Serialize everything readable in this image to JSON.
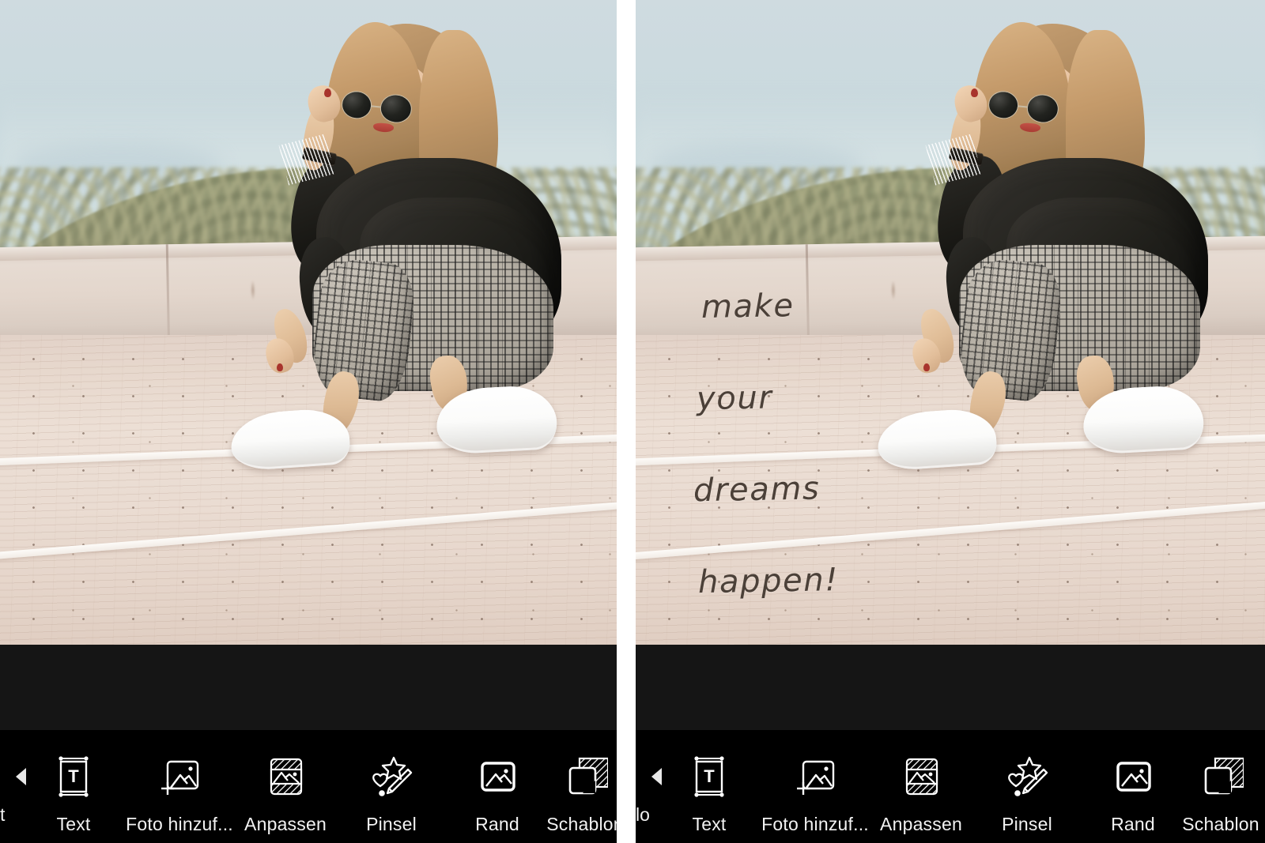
{
  "app": {
    "type": "mobile-photo-editor",
    "layout": "side-by-side-before-after",
    "accent_color": "#ffffff",
    "toolbar_bg": "#000000",
    "editor_bg": "#151515"
  },
  "panels": [
    {
      "id": "before",
      "name": "before-panel",
      "overlay_text_visible": false,
      "overlay_text": "",
      "photo": {
        "subject": "woman crouching on rooftop terrace",
        "alt": "Blonde woman wearing sunglasses, black sweater and grey plaid trousers crouching on a pale cobblestone rooftop with a forested hill and pale blue sky behind",
        "colors": {
          "sky": "#cfdbe0",
          "hill": "#91957a",
          "wall": "#e3d6cc",
          "ground": "#eadcd2",
          "sweater": "#1c1b17",
          "trousers": "#b9b3a8",
          "shoes": "#ffffff",
          "hair": "#c49a6a",
          "nail_polish": "#a8342c",
          "lips": "#b54840"
        }
      },
      "toolbar": {
        "scroll_arrow": "chevron-left",
        "clipped_left_label": "t",
        "items": [
          {
            "id": "text",
            "label": "Text",
            "icon": "text-box-icon"
          },
          {
            "id": "add-photo",
            "label": "Foto hinzuf...",
            "icon": "add-photo-icon"
          },
          {
            "id": "adjust",
            "label": "Anpassen",
            "icon": "adjust-icon"
          },
          {
            "id": "brush",
            "label": "Pinsel",
            "icon": "brush-icon"
          },
          {
            "id": "border",
            "label": "Rand",
            "icon": "border-icon"
          },
          {
            "id": "template",
            "label": "Schablon",
            "icon": "template-icon"
          }
        ]
      }
    },
    {
      "id": "after",
      "name": "after-panel",
      "overlay_text_visible": true,
      "overlay_text_lines": [
        "make",
        "your",
        "dreams",
        "happen!"
      ],
      "overlay_text_color": "#4b4038",
      "overlay_text_style": "handwriting-script",
      "photo": {
        "subject": "woman crouching on rooftop terrace with handwritten text overlay",
        "alt": "Same photo as the before panel with the handwritten words 'make your dreams happen!' added over the wall and pavement at the left",
        "colors": {
          "sky": "#cfdbe0",
          "hill": "#91957a",
          "wall": "#e3d6cc",
          "ground": "#eadcd2",
          "sweater": "#1c1b17",
          "trousers": "#b9b3a8",
          "shoes": "#ffffff",
          "hair": "#c49a6a",
          "nail_polish": "#a8342c",
          "lips": "#b54840"
        }
      },
      "toolbar": {
        "scroll_arrow": "chevron-left",
        "clipped_left_label": "lo",
        "items": [
          {
            "id": "text",
            "label": "Text",
            "icon": "text-box-icon"
          },
          {
            "id": "add-photo",
            "label": "Foto hinzuf...",
            "icon": "add-photo-icon"
          },
          {
            "id": "adjust",
            "label": "Anpassen",
            "icon": "adjust-icon"
          },
          {
            "id": "brush",
            "label": "Pinsel",
            "icon": "brush-icon"
          },
          {
            "id": "border",
            "label": "Rand",
            "icon": "border-icon"
          },
          {
            "id": "template",
            "label": "Schablon",
            "icon": "template-icon"
          }
        ]
      }
    }
  ]
}
